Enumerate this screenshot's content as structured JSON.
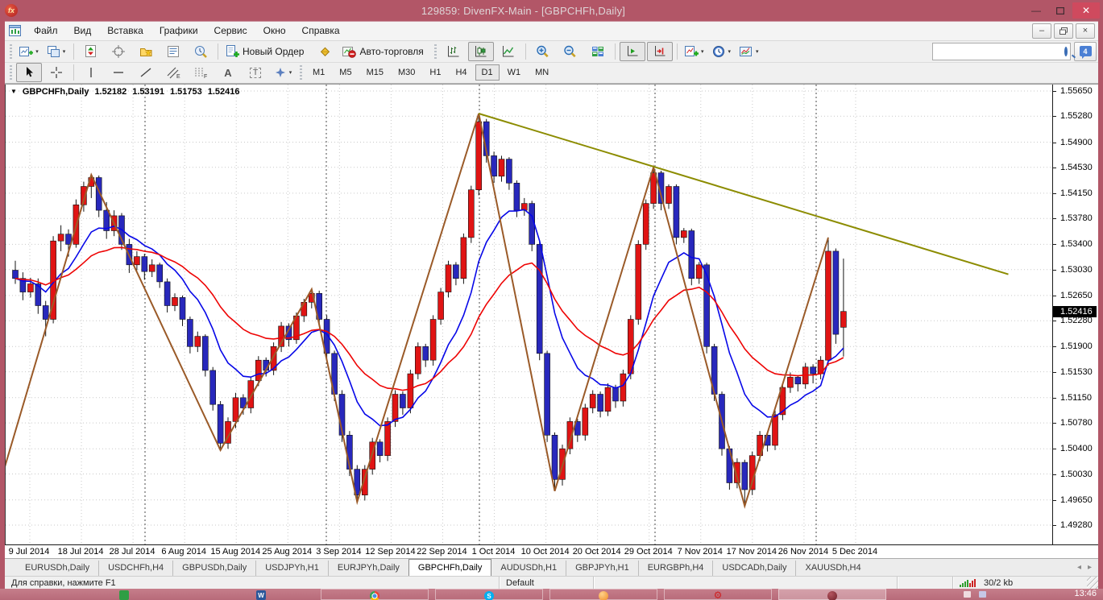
{
  "titlebar": {
    "title": "129859: DivenFX-Main - [GBPCHFh,Daily]",
    "logo_text": "fx"
  },
  "menubar": {
    "items": [
      "Файл",
      "Вид",
      "Вставка",
      "Графики",
      "Сервис",
      "Окно",
      "Справка"
    ]
  },
  "toolbar": {
    "new_order_label": "Новый Ордер",
    "autotrade_label": "Авто-торговля",
    "notification_count": "4",
    "search_value": ""
  },
  "glyphs": {
    "caret": "▾",
    "header_caret": "▼",
    "star": "★",
    "win_minimize": "—",
    "win_close": "✕",
    "child_minimize": "–",
    "child_close": "×",
    "tab_prev": "◂",
    "tab_next": "▸",
    "text_tool": "A",
    "label_tool": "T",
    "channel_sub": "E",
    "fibo_sub": "F",
    "skype_letter": "S",
    "word_letter": "W",
    "green_letter": "◉",
    "gear": "⚙"
  },
  "timeframes": {
    "items": [
      "M1",
      "M5",
      "M15",
      "M30",
      "H1",
      "H4",
      "D1",
      "W1",
      "MN"
    ],
    "active": "D1"
  },
  "chart_header": {
    "symbol": "GBPCHFh,Daily",
    "open": "1.52182",
    "high": "1.53191",
    "low": "1.51753",
    "close": "1.52416"
  },
  "chart_data": {
    "type": "candlestick",
    "symbol": "GBPCHFh,Daily",
    "timeframe": "Daily",
    "last_price": "1.52416",
    "last_candle_ohlc": [
      1.52182,
      1.53191,
      1.51753,
      1.52416
    ],
    "ylim": [
      1.48996,
      1.55745
    ],
    "price_ticks": [
      "1.55650",
      "1.55280",
      "1.54900",
      "1.54530",
      "1.54150",
      "1.53780",
      "1.53400",
      "1.53030",
      "1.52650",
      "1.52280",
      "1.51900",
      "1.51530",
      "1.51150",
      "1.50780",
      "1.50400",
      "1.50030",
      "1.49650",
      "1.49280"
    ],
    "date_ticks": [
      "9 Jul 2014",
      "18 Jul 2014",
      "28 Jul 2014",
      "6 Aug 2014",
      "15 Aug 2014",
      "25 Aug 2014",
      "3 Sep 2014",
      "12 Sep 2014",
      "22 Sep 2014",
      "1 Oct 2014",
      "10 Oct 2014",
      "20 Oct 2014",
      "29 Oct 2014",
      "7 Nov 2014",
      "17 Nov 2014",
      "26 Nov 2014",
      "5 Dec 2014"
    ],
    "candles": [
      [
        1.5302,
        1.5316,
        1.5282,
        1.529
      ],
      [
        1.529,
        1.5299,
        1.5258,
        1.527
      ],
      [
        1.527,
        1.5291,
        1.5262,
        1.5282
      ],
      [
        1.5282,
        1.529,
        1.5238,
        1.525
      ],
      [
        1.525,
        1.5257,
        1.5205,
        1.523
      ],
      [
        1.523,
        1.5352,
        1.5224,
        1.5345
      ],
      [
        1.5345,
        1.5368,
        1.533,
        1.5355
      ],
      [
        1.5355,
        1.5362,
        1.5322,
        1.534
      ],
      [
        1.534,
        1.5406,
        1.5335,
        1.5398
      ],
      [
        1.5398,
        1.5432,
        1.5388,
        1.5425
      ],
      [
        1.5425,
        1.5442,
        1.5408,
        1.5438
      ],
      [
        1.5438,
        1.5441,
        1.538,
        1.539
      ],
      [
        1.539,
        1.5402,
        1.5348,
        1.536
      ],
      [
        1.536,
        1.539,
        1.5352,
        1.5382
      ],
      [
        1.5382,
        1.5386,
        1.5332,
        1.534
      ],
      [
        1.534,
        1.5348,
        1.5298,
        1.531
      ],
      [
        1.531,
        1.533,
        1.5302,
        1.5322
      ],
      [
        1.5322,
        1.5326,
        1.5288,
        1.53
      ],
      [
        1.53,
        1.5318,
        1.5292,
        1.531
      ],
      [
        1.531,
        1.5313,
        1.5276,
        1.5285
      ],
      [
        1.5285,
        1.529,
        1.524,
        1.525
      ],
      [
        1.525,
        1.5268,
        1.5242,
        1.5262
      ],
      [
        1.5262,
        1.5265,
        1.522,
        1.523
      ],
      [
        1.523,
        1.5234,
        1.518,
        1.519
      ],
      [
        1.519,
        1.5212,
        1.5182,
        1.5205
      ],
      [
        1.5205,
        1.5208,
        1.5146,
        1.5155
      ],
      [
        1.5155,
        1.516,
        1.5096,
        1.5105
      ],
      [
        1.5105,
        1.511,
        1.5038,
        1.5048
      ],
      [
        1.5048,
        1.5086,
        1.504,
        1.508
      ],
      [
        1.508,
        1.5122,
        1.507,
        1.5115
      ],
      [
        1.5115,
        1.512,
        1.509,
        1.51
      ],
      [
        1.51,
        1.5146,
        1.5092,
        1.514
      ],
      [
        1.514,
        1.5176,
        1.5132,
        1.517
      ],
      [
        1.517,
        1.5174,
        1.5146,
        1.5155
      ],
      [
        1.5155,
        1.5196,
        1.5148,
        1.519
      ],
      [
        1.519,
        1.5226,
        1.5182,
        1.522
      ],
      [
        1.522,
        1.5224,
        1.519,
        1.52
      ],
      [
        1.52,
        1.524,
        1.5194,
        1.5235
      ],
      [
        1.5235,
        1.526,
        1.5226,
        1.5255
      ],
      [
        1.5255,
        1.5274,
        1.5246,
        1.5268
      ],
      [
        1.5268,
        1.5272,
        1.522,
        1.523
      ],
      [
        1.523,
        1.5236,
        1.517,
        1.518
      ],
      [
        1.518,
        1.5184,
        1.511,
        1.512
      ],
      [
        1.512,
        1.5126,
        1.505,
        1.506
      ],
      [
        1.506,
        1.5066,
        1.5,
        1.501
      ],
      [
        1.501,
        1.5016,
        1.4962,
        1.4972
      ],
      [
        1.4972,
        1.5016,
        1.4964,
        1.501
      ],
      [
        1.501,
        1.5056,
        1.5002,
        1.505
      ],
      [
        1.505,
        1.5054,
        1.502,
        1.503
      ],
      [
        1.503,
        1.5086,
        1.5022,
        1.508
      ],
      [
        1.508,
        1.5126,
        1.5072,
        1.512
      ],
      [
        1.512,
        1.5124,
        1.509,
        1.51
      ],
      [
        1.51,
        1.5156,
        1.5092,
        1.515
      ],
      [
        1.515,
        1.5196,
        1.5142,
        1.519
      ],
      [
        1.519,
        1.5194,
        1.516,
        1.517
      ],
      [
        1.517,
        1.5236,
        1.5162,
        1.523
      ],
      [
        1.523,
        1.5276,
        1.5222,
        1.527
      ],
      [
        1.527,
        1.5316,
        1.5262,
        1.531
      ],
      [
        1.531,
        1.5314,
        1.528,
        1.529
      ],
      [
        1.529,
        1.5356,
        1.5282,
        1.535
      ],
      [
        1.535,
        1.5426,
        1.5342,
        1.542
      ],
      [
        1.542,
        1.5532,
        1.5412,
        1.552
      ],
      [
        1.552,
        1.5524,
        1.546,
        1.547
      ],
      [
        1.547,
        1.5476,
        1.543,
        1.544
      ],
      [
        1.544,
        1.547,
        1.5432,
        1.5465
      ],
      [
        1.5465,
        1.5468,
        1.542,
        1.543
      ],
      [
        1.543,
        1.5434,
        1.538,
        1.539
      ],
      [
        1.539,
        1.5408,
        1.5382,
        1.54
      ],
      [
        1.54,
        1.5404,
        1.533,
        1.534
      ],
      [
        1.534,
        1.5344,
        1.517,
        1.518
      ],
      [
        1.518,
        1.5184,
        1.505,
        1.506
      ],
      [
        1.506,
        1.5064,
        1.4978,
        1.4995
      ],
      [
        1.4995,
        1.5046,
        1.4986,
        1.504
      ],
      [
        1.504,
        1.5086,
        1.5032,
        1.508
      ],
      [
        1.508,
        1.5084,
        1.505,
        1.506
      ],
      [
        1.506,
        1.5106,
        1.5052,
        1.51
      ],
      [
        1.51,
        1.5126,
        1.5092,
        1.512
      ],
      [
        1.512,
        1.5124,
        1.5086,
        1.5095
      ],
      [
        1.5095,
        1.5136,
        1.5088,
        1.513
      ],
      [
        1.513,
        1.5134,
        1.51,
        1.511
      ],
      [
        1.511,
        1.5156,
        1.5102,
        1.515
      ],
      [
        1.515,
        1.5236,
        1.5142,
        1.523
      ],
      [
        1.523,
        1.5346,
        1.5222,
        1.534
      ],
      [
        1.534,
        1.5406,
        1.5332,
        1.54
      ],
      [
        1.54,
        1.5453,
        1.5392,
        1.5445
      ],
      [
        1.5445,
        1.5448,
        1.539,
        1.54
      ],
      [
        1.54,
        1.5428,
        1.5392,
        1.5425
      ],
      [
        1.5425,
        1.5428,
        1.534,
        1.535
      ],
      [
        1.535,
        1.5364,
        1.5342,
        1.536
      ],
      [
        1.536,
        1.5363,
        1.528,
        1.529
      ],
      [
        1.529,
        1.5314,
        1.5282,
        1.531
      ],
      [
        1.531,
        1.5313,
        1.518,
        1.519
      ],
      [
        1.519,
        1.5194,
        1.511,
        1.512
      ],
      [
        1.512,
        1.5124,
        1.503,
        1.504
      ],
      [
        1.504,
        1.5044,
        1.498,
        1.499
      ],
      [
        1.499,
        1.5026,
        1.4982,
        1.502
      ],
      [
        1.502,
        1.5024,
        1.4956,
        1.498
      ],
      [
        1.498,
        1.5036,
        1.4972,
        1.503
      ],
      [
        1.503,
        1.5066,
        1.5022,
        1.506
      ],
      [
        1.506,
        1.5064,
        1.5036,
        1.5045
      ],
      [
        1.5045,
        1.5096,
        1.5038,
        1.509
      ],
      [
        1.509,
        1.5136,
        1.5082,
        1.513
      ],
      [
        1.513,
        1.5152,
        1.5122,
        1.5145
      ],
      [
        1.5145,
        1.5148,
        1.5124,
        1.5135
      ],
      [
        1.5135,
        1.5166,
        1.5128,
        1.516
      ],
      [
        1.516,
        1.5164,
        1.5136,
        1.515
      ],
      [
        1.515,
        1.5176,
        1.5142,
        1.517
      ],
      [
        1.517,
        1.535,
        1.5162,
        1.533
      ],
      [
        1.533,
        1.5334,
        1.5194,
        1.5208
      ],
      [
        1.52182,
        1.53191,
        1.51753,
        1.52416
      ]
    ],
    "indicators": [
      {
        "name": "ma-fast",
        "type": "ema",
        "period": 10,
        "color": "#0707e8"
      },
      {
        "name": "ma-slow",
        "type": "ema",
        "period": 24,
        "color": "#ee0404"
      }
    ],
    "zigzag": {
      "color": "#9a5a28",
      "points": [
        [
          -2,
          1.499
        ],
        [
          10,
          1.5442
        ],
        [
          27,
          1.5038
        ],
        [
          39,
          1.5274
        ],
        [
          45,
          1.4962
        ],
        [
          61,
          1.5532
        ],
        [
          71,
          1.4978
        ],
        [
          84,
          1.5453
        ],
        [
          96,
          1.4956
        ],
        [
          107,
          1.535
        ]
      ]
    },
    "trendline": {
      "color": "#8c8c00",
      "from": [
        61,
        1.5532
      ],
      "to": [
        130.7,
        1.5296
      ]
    },
    "layout": {
      "x0": 12,
      "dx": 9.43,
      "body_w": 7,
      "date_x0": 30,
      "date_dx": 64.06,
      "separators_x": [
        173,
        398,
        588,
        806,
        1006
      ],
      "grid_color": "#c9c9c9",
      "bull": "#e01414",
      "bear": "#2828bc",
      "wick": "#151515"
    }
  },
  "tabs": {
    "items": [
      "EURUSDh,Daily",
      "USDCHFh,H4",
      "GBPUSDh,Daily",
      "USDJPYh,H1",
      "EURJPYh,Daily",
      "GBPCHFh,Daily",
      "AUDUSDh,H1",
      "GBPJPYh,H1",
      "EURGBPh,H4",
      "USDCADh,Daily",
      "XAUUSDh,H4"
    ],
    "active": "GBPCHFh,Daily"
  },
  "statusbar": {
    "help": "Для справки, нажмите F1",
    "profile": "Default",
    "traffic": "30/2 kb"
  },
  "taskbar": {
    "clock": "13:46"
  }
}
